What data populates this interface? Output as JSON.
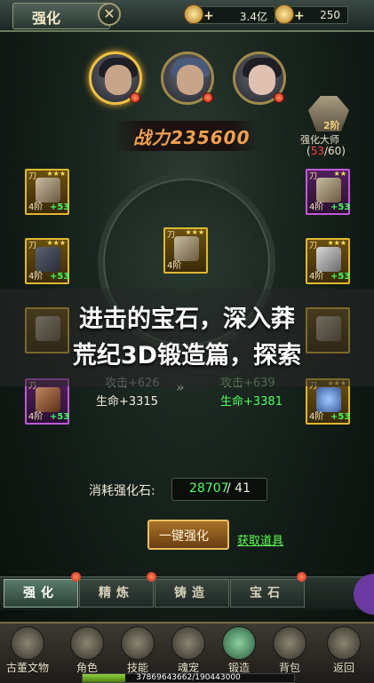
{
  "header": {
    "title": "强化",
    "close_label": "✕"
  },
  "resources": [
    {
      "name": "silver",
      "plus": "+",
      "value": "3.4亿"
    },
    {
      "name": "gold",
      "plus": "+",
      "value": "250"
    }
  ],
  "power": {
    "text": "战力235600"
  },
  "master": {
    "rank": "2阶",
    "title": "强化大师",
    "progress_current": "53",
    "progress_sep": "/60)",
    "progress_open": "("
  },
  "slots": {
    "mark": "刀",
    "stars": "★★★",
    "tier": "4阶",
    "plus": "+53"
  },
  "center_slot": {
    "tier": "4阶",
    "stars": "★★★"
  },
  "stats": {
    "left_attack": "攻击+626",
    "left_hp": "生命+3315",
    "right_attack": "攻击+639",
    "right_hp": "生命+3381"
  },
  "banner": {
    "line1": "进击的宝石，深入莽",
    "line2": "荒纪3D锻造篇，探索"
  },
  "cost": {
    "label": "消耗强化石:",
    "have": "28707",
    "need": " / 41"
  },
  "actions": {
    "strengthen": "一键强化",
    "get_items": "获取道具"
  },
  "tabs": [
    {
      "label": "强化",
      "active": true
    },
    {
      "label": "精炼",
      "active": false
    },
    {
      "label": "铸造",
      "active": false
    },
    {
      "label": "宝石",
      "active": false
    }
  ],
  "nav": [
    {
      "label": "古董文物"
    },
    {
      "label": "角色"
    },
    {
      "label": "技能"
    },
    {
      "label": "魂宠"
    },
    {
      "label": "锻造"
    },
    {
      "label": "背包"
    },
    {
      "label": "返回"
    }
  ],
  "exp": {
    "text": "37869643662/190443000",
    "fraction": 0.2
  },
  "colors": {
    "accent_gold": "#e0b830",
    "stat_green": "#50ff60",
    "epic_purple": "#c05ad8"
  }
}
